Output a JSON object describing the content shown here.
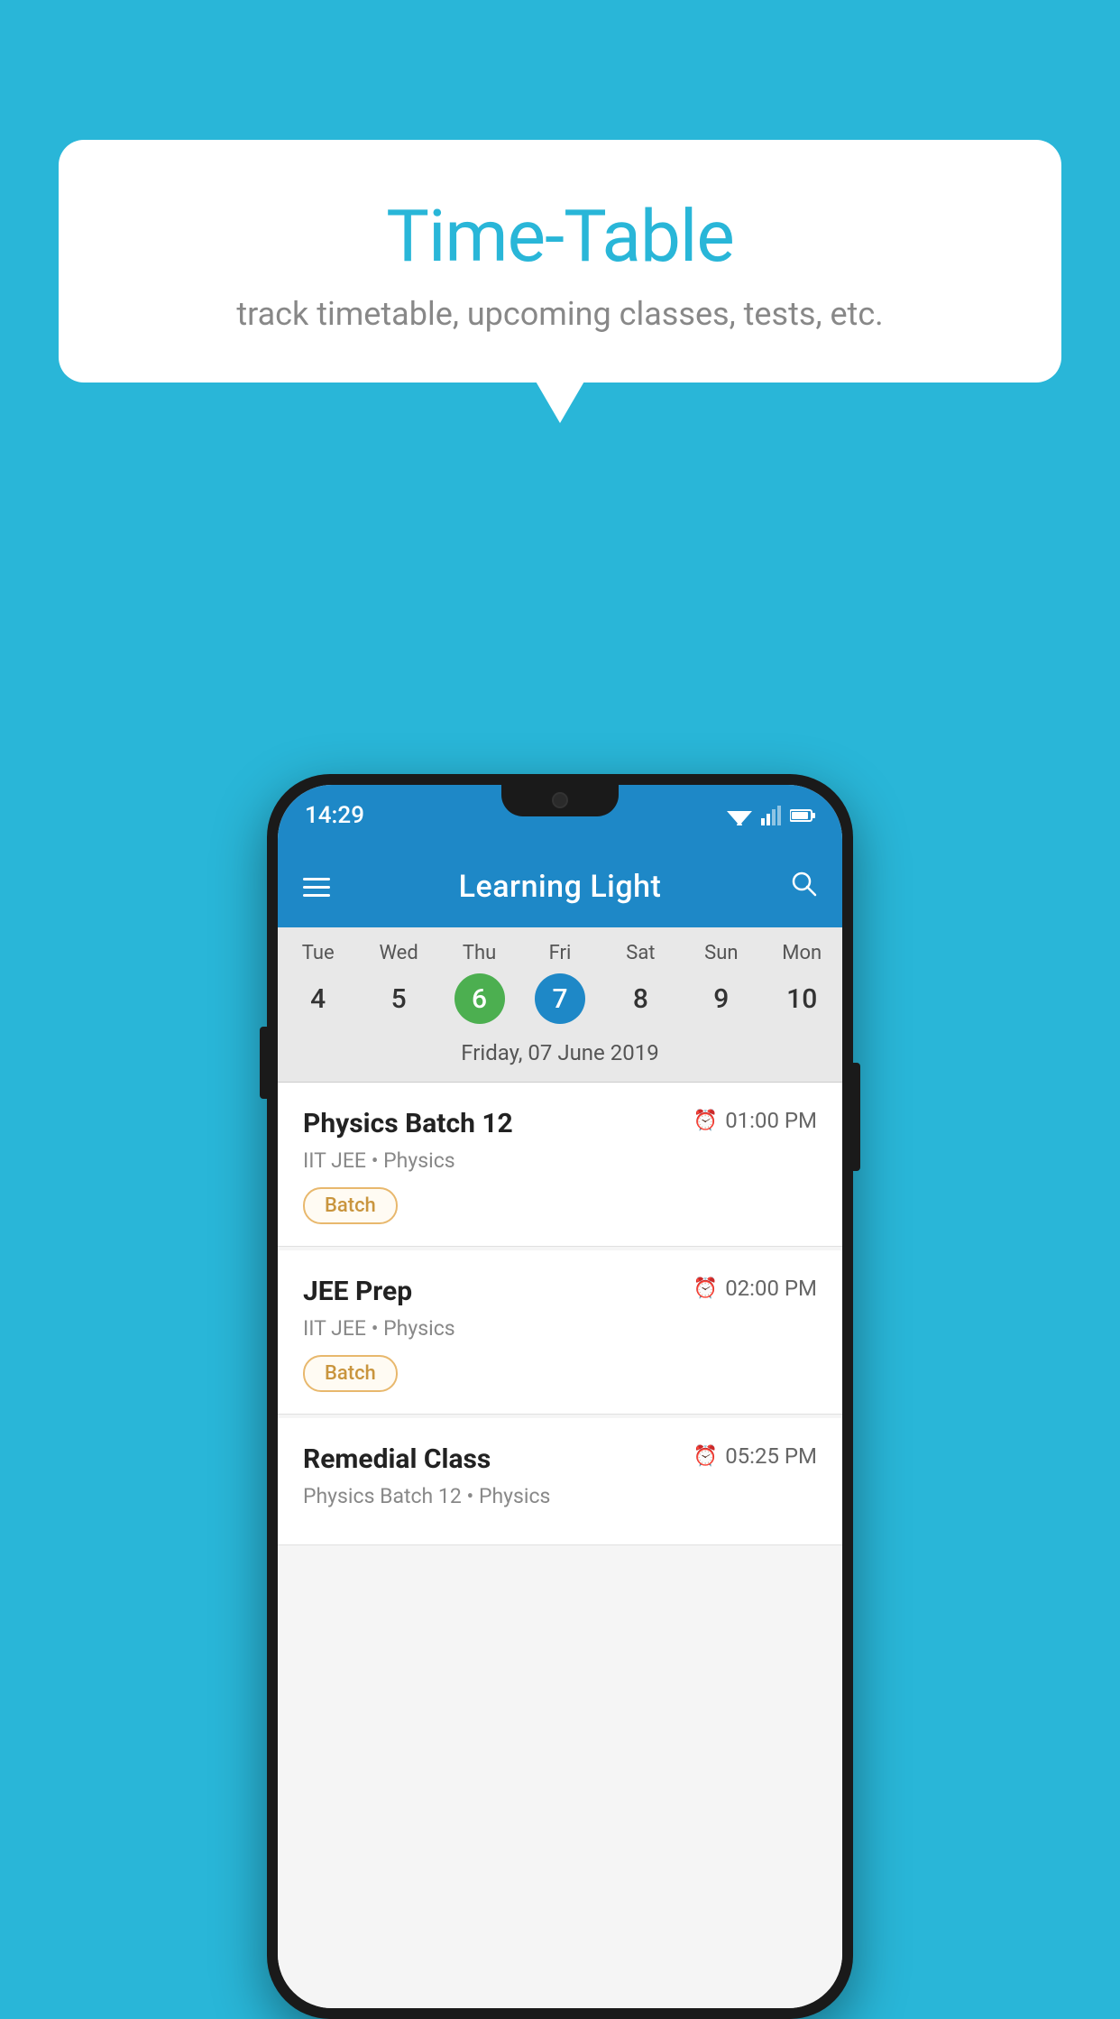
{
  "background_color": "#29b6d8",
  "tooltip": {
    "title": "Time-Table",
    "subtitle": "track timetable, upcoming classes, tests, etc."
  },
  "phone": {
    "status_bar": {
      "time": "14:29"
    },
    "app_bar": {
      "title": "Learning Light",
      "menu_icon_label": "menu-icon",
      "search_icon_label": "search-icon"
    },
    "calendar": {
      "days": [
        {
          "name": "Tue",
          "number": "4",
          "state": "normal"
        },
        {
          "name": "Wed",
          "number": "5",
          "state": "normal"
        },
        {
          "name": "Thu",
          "number": "6",
          "state": "today"
        },
        {
          "name": "Fri",
          "number": "7",
          "state": "selected"
        },
        {
          "name": "Sat",
          "number": "8",
          "state": "normal"
        },
        {
          "name": "Sun",
          "number": "9",
          "state": "normal"
        },
        {
          "name": "Mon",
          "number": "10",
          "state": "normal"
        }
      ],
      "selected_date_label": "Friday, 07 June 2019"
    },
    "classes": [
      {
        "name": "Physics Batch 12",
        "time": "01:00 PM",
        "meta": "IIT JEE • Physics",
        "badge": "Batch"
      },
      {
        "name": "JEE Prep",
        "time": "02:00 PM",
        "meta": "IIT JEE • Physics",
        "badge": "Batch"
      },
      {
        "name": "Remedial Class",
        "time": "05:25 PM",
        "meta": "Physics Batch 12 • Physics",
        "badge": ""
      }
    ]
  }
}
